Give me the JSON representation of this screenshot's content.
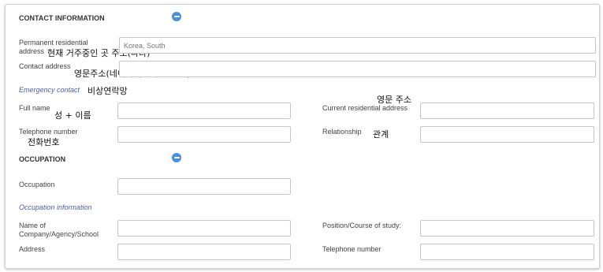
{
  "contact": {
    "title": "CONTACT INFORMATION",
    "permanent_address_label_1": "Permanent residential",
    "permanent_address_label_2": "address",
    "permanent_address_value": "Korea, South",
    "permanent_address_note": "현재 거주중인 곳 주소(나라)",
    "contact_address_label": "Contact address",
    "contact_address_note": "영문주소(네이버 영문주소 참조)"
  },
  "emergency": {
    "subtitle": "Emergency contact",
    "subtitle_note": "비상연락망",
    "full_name_label": "Full name",
    "full_name_note": "성 + 이름",
    "current_address_label": "Current residential address",
    "current_address_note": "영문 주소",
    "telephone_label": "Telephone number",
    "telephone_note": "전화번호",
    "relationship_label": "Relationship",
    "relationship_note": "관계"
  },
  "occupation": {
    "title": "OCCUPATION",
    "occupation_label": "Occupation",
    "subtitle": "Occupation information",
    "company_label_1": "Name of",
    "company_label_2": "Company/Agency/School",
    "position_label": "Position/Course of study:",
    "address_label": "Address",
    "telephone_label": "Telephone number"
  },
  "icons": {
    "collapse": "minus-circle-icon"
  },
  "colors": {
    "accent": "#4a90d9",
    "subtitle": "#4a5fa8",
    "border": "#c7c7c7"
  }
}
